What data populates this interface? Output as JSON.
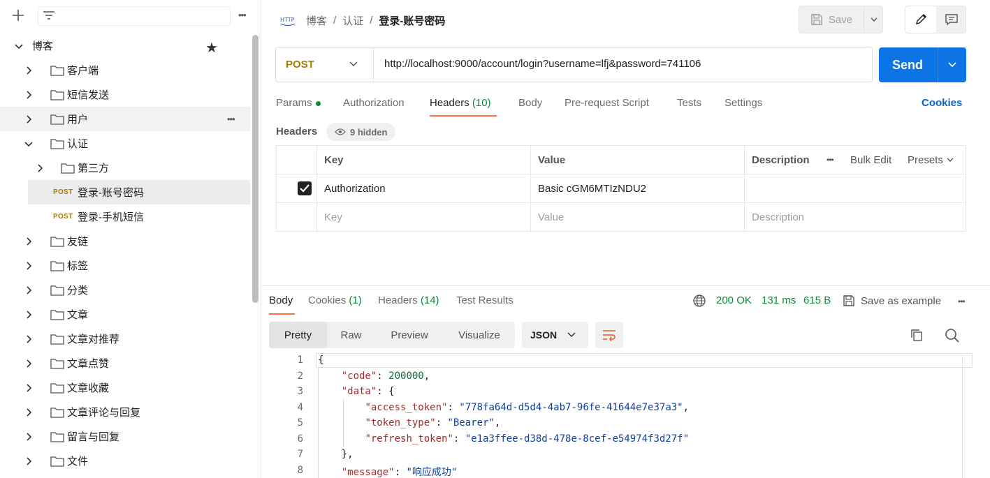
{
  "sidebar": {
    "more_label": "•••",
    "collection": {
      "name": "博客"
    },
    "items": [
      {
        "label": "客户端"
      },
      {
        "label": "短信发送"
      },
      {
        "label": "用户"
      },
      {
        "label": "认证"
      },
      {
        "label": "第三方"
      },
      {
        "method": "POST",
        "label": "登录-账号密码"
      },
      {
        "method": "POST",
        "label": "登录-手机短信"
      },
      {
        "label": "友链"
      },
      {
        "label": "标签"
      },
      {
        "label": "分类"
      },
      {
        "label": "文章"
      },
      {
        "label": "文章对推荐"
      },
      {
        "label": "文章点赞"
      },
      {
        "label": "文章收藏"
      },
      {
        "label": "文章评论与回复"
      },
      {
        "label": "留言与回复"
      },
      {
        "label": "文件"
      }
    ]
  },
  "breadcrumb": {
    "http_label": "HTTP",
    "parts": [
      "博客",
      "认证"
    ],
    "current": "登录-账号密码",
    "sep": "/"
  },
  "toolbar": {
    "save_label": "Save"
  },
  "request": {
    "method": "POST",
    "url": "http://localhost:9000/account/login?username=lfj&password=741106",
    "send_label": "Send"
  },
  "req_tabs": {
    "params": "Params",
    "authorization": "Authorization",
    "headers": "Headers",
    "headers_count": "(10)",
    "body": "Body",
    "prerequest": "Pre-request Script",
    "tests": "Tests",
    "settings": "Settings",
    "cookies": "Cookies"
  },
  "headers_section": {
    "label": "Headers",
    "hidden": "9 hidden",
    "columns": {
      "key": "Key",
      "value": "Value",
      "description": "Description"
    },
    "bulk_edit": "Bulk Edit",
    "presets": "Presets",
    "more": "•••",
    "rows": [
      {
        "key": "Authorization",
        "value": "Basic cGM6MTIzNDU2",
        "description": ""
      }
    ],
    "placeholder": {
      "key": "Key",
      "value": "Value",
      "description": "Description"
    }
  },
  "response": {
    "tabs": {
      "body": "Body",
      "cookies": "Cookies",
      "cookies_count": "(1)",
      "headers": "Headers",
      "headers_count": "(14)",
      "tests": "Test Results"
    },
    "status": "200 OK",
    "time": "131 ms",
    "size": "615 B",
    "save_example": "Save as example",
    "more": "•••",
    "views": [
      "Pretty",
      "Raw",
      "Preview",
      "Visualize"
    ],
    "format": "JSON"
  },
  "code": {
    "line_numbers": [
      "1",
      "2",
      "3",
      "4",
      "5",
      "6",
      "7",
      "8"
    ],
    "code_key": "\"code\"",
    "code_val": "200000",
    "data_key": "\"data\"",
    "access_token_key": "\"access_token\"",
    "access_token_val": "\"778fa64d-d5d4-4ab7-96fe-41644e7e37a3\"",
    "token_type_key": "\"token_type\"",
    "token_type_val": "\"Bearer\"",
    "refresh_token_key": "\"refresh_token\"",
    "refresh_token_val": "\"e1a3ffee-d38d-478e-8cef-e54974f3d27f\"",
    "message_key": "\"message\"",
    "message_val": "\"响应成功\""
  },
  "colors": {
    "accent": "#0c74e4",
    "method": "#a97a00",
    "success": "#0b8a3a",
    "tab_underline": "#ff6c37"
  }
}
